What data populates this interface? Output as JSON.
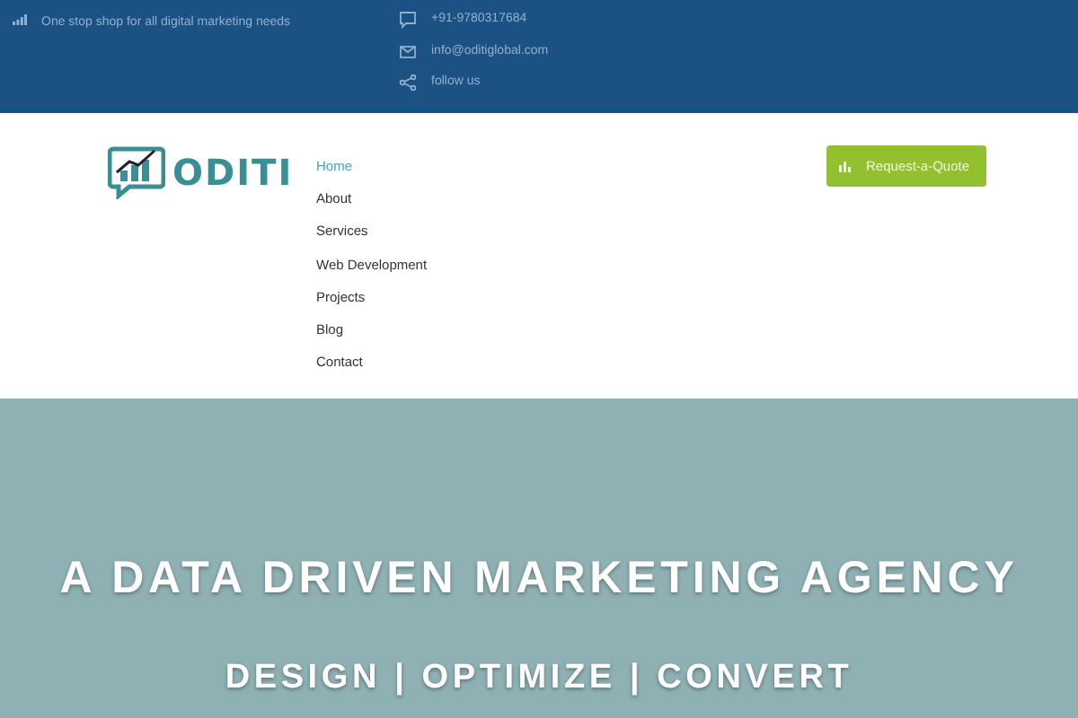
{
  "topbar": {
    "tagline": "One stop shop for all digital marketing needs",
    "contacts": [
      {
        "kind": "phone",
        "text": "+91-9780317684"
      },
      {
        "kind": "email",
        "text": "info@oditiglobal.com"
      },
      {
        "kind": "share",
        "text": "follow us"
      }
    ]
  },
  "header": {
    "logo_text": "ODITI",
    "nav": [
      {
        "label": "Home",
        "selected": true
      },
      {
        "label": "About",
        "selected": false
      },
      {
        "label": "Services",
        "selected": false
      },
      {
        "label": "Web Development",
        "selected": false
      },
      {
        "label": "Projects",
        "selected": false
      },
      {
        "label": "Blog",
        "selected": false
      },
      {
        "label": "Contact",
        "selected": false
      }
    ],
    "cta": "Request-a-Quote"
  },
  "hero": {
    "headline": "A DATA DRIVEN MARKETING AGENCY",
    "subheadline": "DESIGN | OPTIMIZE | CONVERT"
  }
}
